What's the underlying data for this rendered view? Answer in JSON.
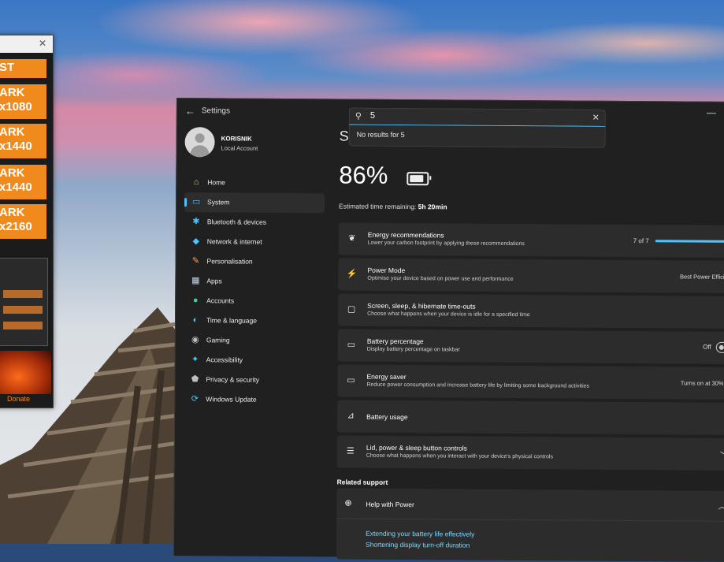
{
  "left_app": {
    "buttons": [
      "ST",
      "ARK\nx1080",
      "ARK\nx1440",
      "ARK\nx1440",
      "ARK\nx2160"
    ],
    "donate": "Donate",
    "close": "✕"
  },
  "settings": {
    "title": "Settings",
    "search": {
      "value": "5",
      "no_results": "No results for 5"
    },
    "user": {
      "name": "KORISNIK",
      "type": "Local Account"
    },
    "nav": [
      {
        "label": "Home",
        "icon": "home-icon",
        "glyph": "⌂",
        "color": "#ffd27a"
      },
      {
        "label": "System",
        "icon": "system-icon",
        "glyph": "▭",
        "color": "#4cc2ff"
      },
      {
        "label": "Bluetooth & devices",
        "icon": "bluetooth-icon",
        "glyph": "✱",
        "color": "#4cc2ff"
      },
      {
        "label": "Network & internet",
        "icon": "network-icon",
        "glyph": "◆",
        "color": "#4cc2ff"
      },
      {
        "label": "Personalisation",
        "icon": "brush-icon",
        "glyph": "✎",
        "color": "#f7a35a"
      },
      {
        "label": "Apps",
        "icon": "apps-icon",
        "glyph": "▦",
        "color": "#c8d4e8"
      },
      {
        "label": "Accounts",
        "icon": "accounts-icon",
        "glyph": "●",
        "color": "#3fd0a0"
      },
      {
        "label": "Time & language",
        "icon": "globe-icon",
        "glyph": "◐",
        "color": "#4cc2ff"
      },
      {
        "label": "Gaming",
        "icon": "gaming-icon",
        "glyph": "◉",
        "color": "#bdbdbd"
      },
      {
        "label": "Accessibility",
        "icon": "accessibility-icon",
        "glyph": "✦",
        "color": "#4cc2ff"
      },
      {
        "label": "Privacy & security",
        "icon": "shield-icon",
        "glyph": "⬟",
        "color": "#bdbdbd"
      },
      {
        "label": "Windows Update",
        "icon": "update-icon",
        "glyph": "⟳",
        "color": "#4cc2ff"
      }
    ],
    "page_title_partial": "Sy",
    "battery_percent": "86%",
    "battery_level": 0.86,
    "estimated_label": "Estimated time remaining:",
    "estimated_value": "5h 20min",
    "cards": [
      {
        "title": "Energy recommendations",
        "desc": "Lower your carbon footprint by applying these recommendations",
        "value": "7 of 7",
        "icon": "leaf-icon",
        "glyph": "❦"
      },
      {
        "title": "Power Mode",
        "desc": "Optimise your device based on power use and performance",
        "value": "Best Power Efficiency",
        "icon": "power-mode-icon",
        "glyph": "⚡"
      },
      {
        "title": "Screen, sleep, & hibernate time-outs",
        "desc": "Choose what happens when your device is idle for a specified time",
        "value": "",
        "icon": "screen-sleep-icon",
        "glyph": "▢"
      },
      {
        "title": "Battery percentage",
        "desc": "Display battery percentage on taskbar",
        "value": "Off",
        "icon": "battery-icon",
        "glyph": "▭"
      },
      {
        "title": "Energy saver",
        "desc": "Reduce power consumption and increase battery life by limiting some background activities",
        "value": "Turns on at 30%",
        "icon": "energy-saver-icon",
        "glyph": "▭"
      },
      {
        "title": "Battery usage",
        "desc": "",
        "value": "",
        "icon": "chart-icon",
        "glyph": "⊿"
      },
      {
        "title": "Lid, power & sleep button controls",
        "desc": "Choose what happens when you interact with your device's physical controls",
        "value": "",
        "icon": "list-icon",
        "glyph": "☰"
      }
    ],
    "energy_progress": 1.0,
    "related_support": "Related support",
    "help": {
      "title": "Help with Power",
      "links": [
        "Extending your battery life effectively",
        "Shortening display turn-off duration"
      ]
    }
  }
}
